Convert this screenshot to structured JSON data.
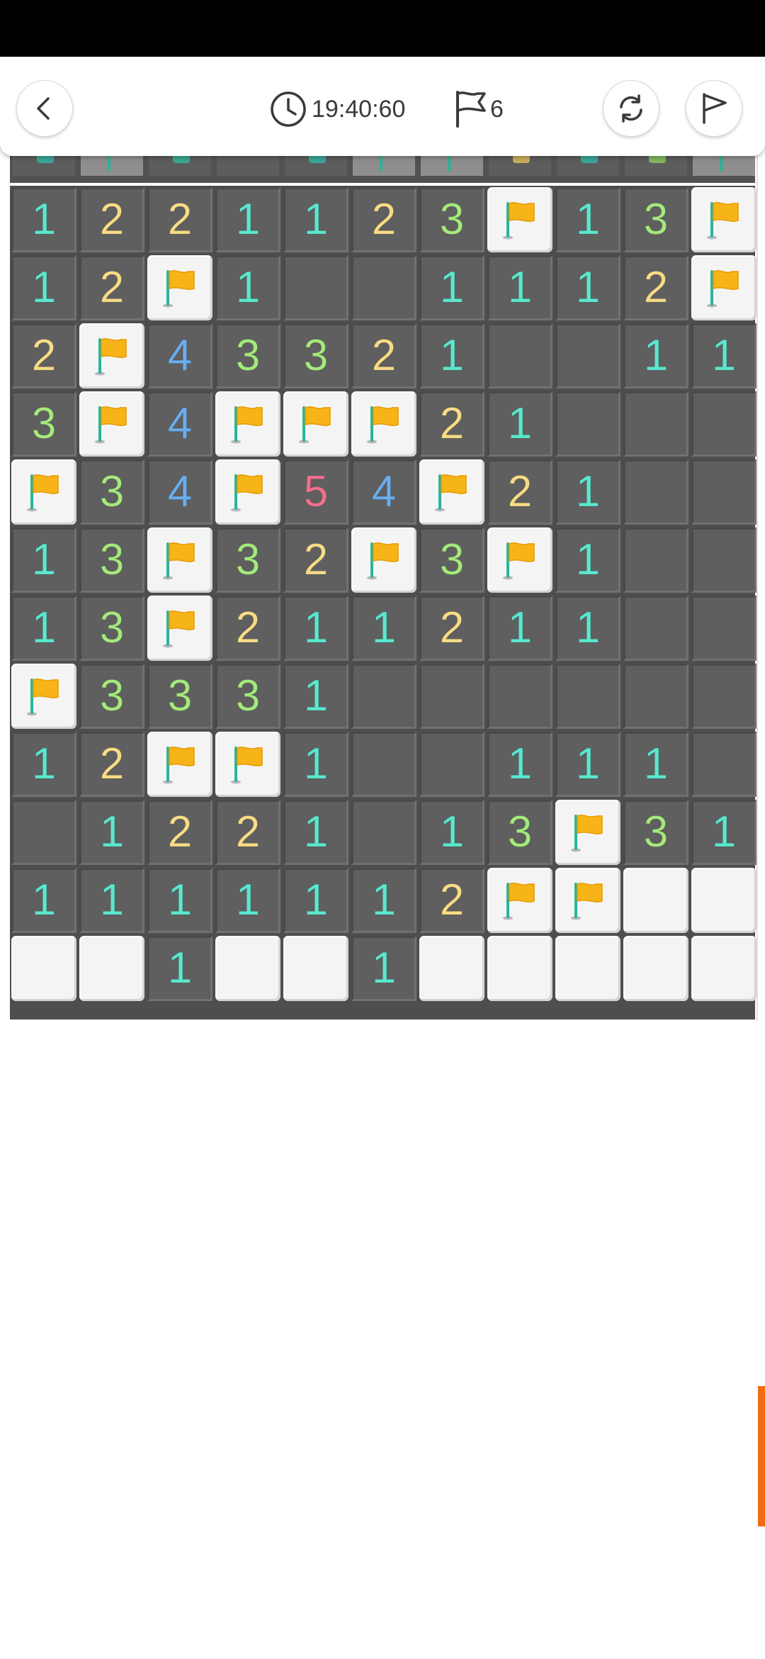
{
  "header": {
    "timer": "19:40:60",
    "flag_count": "6",
    "icons": {
      "back": "chevron-left-icon",
      "clock": "clock-icon",
      "flag": "flag-outline-icon",
      "restart": "refresh-icon",
      "flag_mode": "flag-outline-icon"
    }
  },
  "board": {
    "columns": 11,
    "rows": [
      [
        "1",
        "2",
        "2",
        "1",
        "1",
        "2",
        "3",
        "F",
        "1",
        "3",
        "F"
      ],
      [
        "1",
        "2",
        "F",
        "1",
        "",
        "",
        "1",
        "1",
        "1",
        "2",
        "F"
      ],
      [
        "2",
        "F",
        "4",
        "3",
        "3",
        "2",
        "1",
        "",
        "",
        "1",
        "1"
      ],
      [
        "3",
        "F",
        "4",
        "F",
        "F",
        "F",
        "2",
        "1",
        "",
        "",
        ""
      ],
      [
        "F",
        "3",
        "4",
        "F",
        "5",
        "4",
        "F",
        "2",
        "1",
        "",
        ""
      ],
      [
        "1",
        "3",
        "F",
        "3",
        "2",
        "F",
        "3",
        "F",
        "1",
        "",
        ""
      ],
      [
        "1",
        "3",
        "F",
        "2",
        "1",
        "1",
        "2",
        "1",
        "1",
        "",
        ""
      ],
      [
        "F",
        "3",
        "3",
        "3",
        "1",
        "",
        "",
        "",
        "",
        "",
        ""
      ],
      [
        "1",
        "2",
        "F",
        "F",
        "1",
        "",
        "",
        "1",
        "1",
        "1",
        ""
      ],
      [
        "",
        "1",
        "2",
        "2",
        "1",
        "",
        "1",
        "3",
        "F",
        "3",
        "1"
      ],
      [
        "1",
        "1",
        "1",
        "1",
        "1",
        "1",
        "2",
        "F",
        "F",
        "H",
        "H"
      ],
      [
        "H",
        "H",
        "1",
        "H",
        "H",
        "1",
        "H",
        "H",
        "H",
        "H",
        "H"
      ]
    ],
    "legend": {
      "F": "flagged unrevealed cell",
      "H": "unrevealed cell",
      "empty": "revealed blank cell"
    },
    "top_strip_partial_row": [
      "open-teal",
      "flag",
      "open-teal",
      "blank",
      "open-teal",
      "flag",
      "flag",
      "open-yellow",
      "open-teal",
      "open-green",
      "flag"
    ]
  },
  "colors": {
    "1": "#5be8cf",
    "2": "#f8dc86",
    "3": "#a4ea7c",
    "4": "#6aaeef",
    "5": "#f2708f",
    "flag": "#f7b418",
    "flag_pole": "#2bb39a",
    "accent_scroll": "#f36b12"
  }
}
